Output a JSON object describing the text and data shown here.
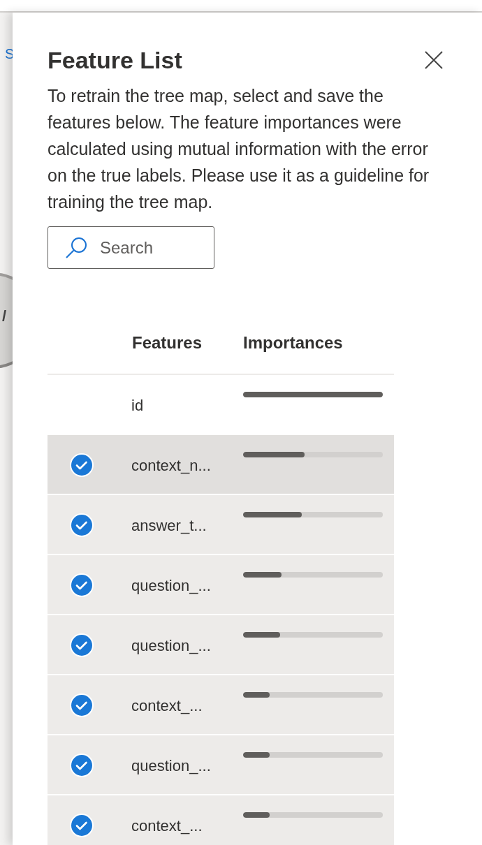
{
  "background": {
    "link_text": "S",
    "gauge_text": "/"
  },
  "panel": {
    "title": "Feature List",
    "description": "To retrain the tree map, select and save the features below. The feature importances were calculated using mutual information with the error on the true labels. Please use it as a guideline for training the tree map.",
    "search": {
      "placeholder": "Search"
    },
    "columns": [
      "Features",
      "Importances"
    ],
    "rows": [
      {
        "feature": "id",
        "selected": false,
        "hovered": false,
        "level": 1.0
      },
      {
        "feature": "context_n...",
        "selected": true,
        "hovered": true,
        "level": 0.44
      },
      {
        "feature": "answer_t...",
        "selected": true,
        "hovered": false,
        "level": 0.42
      },
      {
        "feature": "question_...",
        "selected": true,
        "hovered": false,
        "level": 0.275
      },
      {
        "feature": "question_...",
        "selected": true,
        "hovered": false,
        "level": 0.265
      },
      {
        "feature": "context_...",
        "selected": true,
        "hovered": false,
        "level": 0.19
      },
      {
        "feature": "question_...",
        "selected": true,
        "hovered": false,
        "level": 0.19
      },
      {
        "feature": "context_...",
        "selected": true,
        "hovered": false,
        "level": 0.19
      }
    ]
  }
}
